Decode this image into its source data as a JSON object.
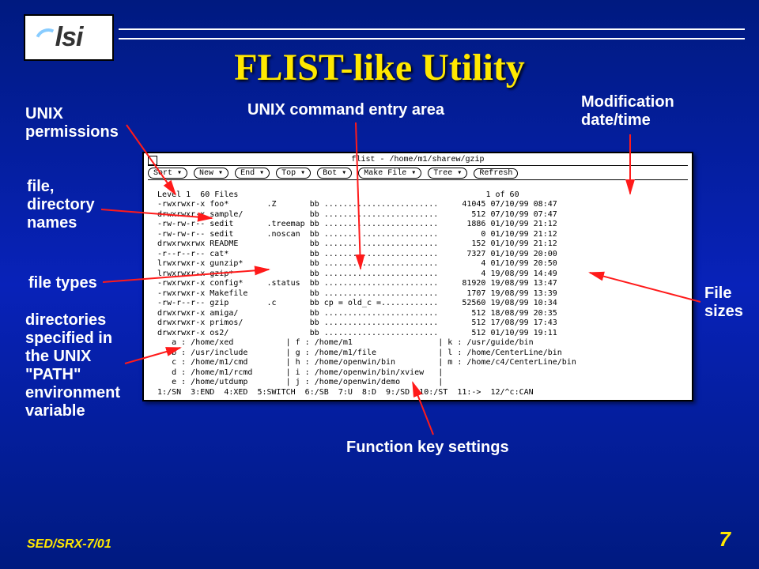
{
  "title": "FLIST-like Utility",
  "logo": "lsi",
  "footer_left": "SED/SRX-7/01",
  "page_number": "7",
  "annotations": {
    "unix_perms": "UNIX\npermissions",
    "file_names": "file,\ndirectory\nnames",
    "file_types": "file types",
    "dirs_path": "directories\nspecified in\nthe UNIX\n\"PATH\"\nenvironment\nvariable",
    "cmd_entry": "UNIX  command  entry  area",
    "mod_time": "Modification\ndate/time",
    "file_sizes": "File\nsizes",
    "fn_keys": "Function  key  settings"
  },
  "terminal": {
    "window_title": "flist - /home/m1/sharew/gzip",
    "menus": [
      "Sort ▾",
      "New ▾",
      "End ▾",
      "Top ▾",
      "Bot ▾",
      "Make File ▾",
      "Tree ▾",
      "Refresh"
    ],
    "header_left": "Level 1  60 Files",
    "header_right": "1 of 60",
    "rows": [
      {
        "perm": "-rwxrwxr-x",
        "name": "foo*",
        "ext": ".Z",
        "own": "bb",
        "dots": "........................",
        "size": "41045",
        "dt": "07/10/99 08:47"
      },
      {
        "perm": "drwxrwxr-x",
        "name": "sample/",
        "ext": "",
        "own": "bb",
        "dots": "........................",
        "size": "512",
        "dt": "07/10/99 07:47"
      },
      {
        "perm": "-rw-rw-r--",
        "name": "sedit",
        "ext": ".treemap",
        "own": "bb",
        "dots": "........................",
        "size": "1886",
        "dt": "01/10/99 21:12"
      },
      {
        "perm": "-rw-rw-r--",
        "name": "sedit",
        "ext": ".noscan",
        "own": "bb",
        "dots": "........................",
        "size": "0",
        "dt": "01/10/99 21:12"
      },
      {
        "perm": "drwxrwxrwx",
        "name": "README",
        "ext": "",
        "own": "bb",
        "dots": "........................",
        "size": "152",
        "dt": "01/10/99 21:12"
      },
      {
        "perm": "-r--r--r--",
        "name": "cat*",
        "ext": "",
        "own": "bb",
        "dots": "........................",
        "size": "7327",
        "dt": "01/10/99 20:00"
      },
      {
        "perm": "lrwxrwxr-x",
        "name": "gunzip*",
        "ext": "",
        "own": "bb",
        "dots": "........................",
        "size": "4",
        "dt": "01/10/99 20:50"
      },
      {
        "perm": "lrwxrwxr-x",
        "name": "gzip*",
        "ext": "",
        "own": "bb",
        "dots": "........................",
        "size": "4",
        "dt": "19/08/99 14:49"
      },
      {
        "perm": "-rwxrwxr-x",
        "name": "config*",
        "ext": ".status",
        "own": "bb",
        "dots": "........................",
        "size": "81920",
        "dt": "19/08/99 13:47"
      },
      {
        "perm": "-rwxrwxr-x",
        "name": "Makefile",
        "ext": "",
        "own": "bb",
        "dots": "........................",
        "size": "1707",
        "dt": "19/08/99 13:39"
      },
      {
        "perm": "-rw-r--r--",
        "name": "gzip",
        "ext": ".c",
        "own": "bb",
        "dots": "cp = old_c =............",
        "size": "52560",
        "dt": "19/08/99 10:34"
      },
      {
        "perm": "drwxrwxr-x",
        "name": "amiga/",
        "ext": "",
        "own": "bb",
        "dots": "........................",
        "size": "512",
        "dt": "18/08/99 20:35"
      },
      {
        "perm": "drwxrwxr-x",
        "name": "primos/",
        "ext": "",
        "own": "bb",
        "dots": "........................",
        "size": "512",
        "dt": "17/08/99 17:43"
      },
      {
        "perm": "drwxrwxr-x",
        "name": "os2/",
        "ext": "",
        "own": "bb",
        "dots": "........................",
        "size": "512",
        "dt": "01/10/99 19:11"
      }
    ],
    "path_cols": [
      [
        "a : /home/xed",
        "b : /usr/include",
        "c : /home/m1/cmd",
        "d : /home/m1/rcmd",
        "e : /home/utdump"
      ],
      [
        "f : /home/m1",
        "g : /home/m1/file",
        "h : /home/openwin/bin",
        "i : /home/openwin/bin/xview",
        "j : /home/openwin/demo"
      ],
      [
        "k : /usr/guide/bin",
        "l : /home/CenterLine/bin",
        "m : /home/c4/CenterLine/bin"
      ]
    ],
    "fn_keys": "1:/SN  3:END  4:XED  5:SWITCH  6:/SB  7:U  8:D  9:/SD  10:/ST  11:->  12/^c:CAN"
  }
}
